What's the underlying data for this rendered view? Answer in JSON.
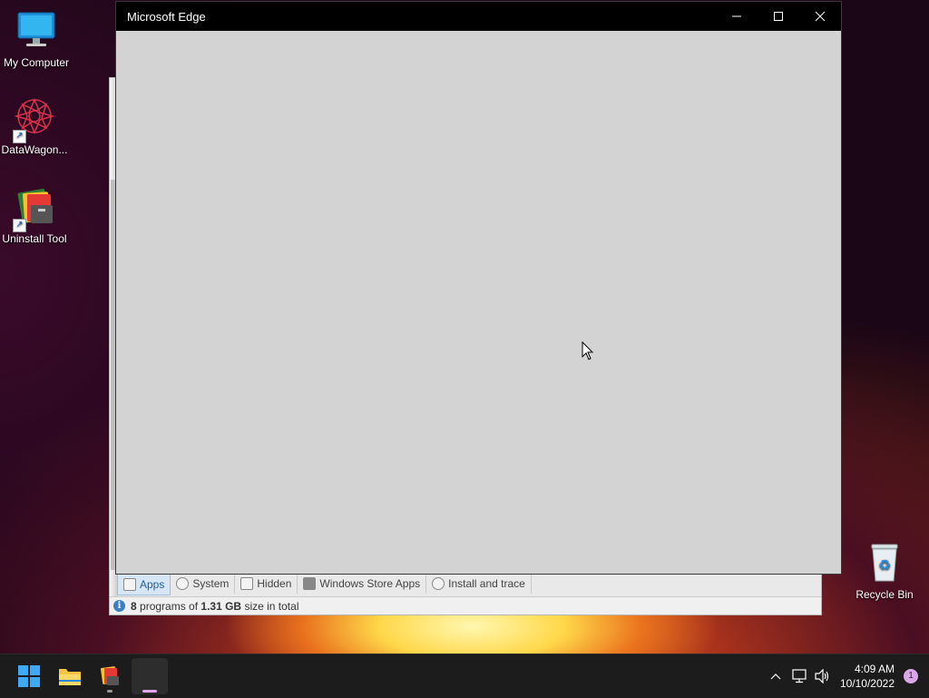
{
  "desktop": {
    "icons": [
      {
        "label": "My Computer",
        "icon": "computer-icon"
      },
      {
        "label": "DataWagon...",
        "icon": "datawagon-icon"
      },
      {
        "label": "Uninstall Tool",
        "icon": "uninstall-tool-icon"
      }
    ],
    "recycle_bin": {
      "label": "Recycle Bin",
      "icon": "recycle-bin-icon"
    }
  },
  "uninstall_tool": {
    "tabs": [
      {
        "label": "Apps",
        "active": true
      },
      {
        "label": "System",
        "active": false
      },
      {
        "label": "Hidden",
        "active": false
      },
      {
        "label": "Windows Store Apps",
        "active": false
      },
      {
        "label": "Install and trace",
        "active": false
      }
    ],
    "status": {
      "count": "8",
      "text1": "programs of",
      "size": "1.31 GB",
      "text2": "size in total"
    }
  },
  "edge_window": {
    "title": "Microsoft Edge",
    "controls": [
      "minimize-icon",
      "maximize-icon",
      "close-icon"
    ]
  },
  "taskbar": {
    "apps": [
      "windows-start-icon",
      "file-explorer-icon",
      "uninstall-tool-icon",
      "blank-app-icon"
    ],
    "tray": {
      "time": "4:09 AM",
      "date": "10/10/2022",
      "notification_count": "1"
    }
  },
  "colors": {
    "accent": "#0078d4",
    "taskbar": "#1c1c1c",
    "edge_titlebar": "#000000"
  }
}
